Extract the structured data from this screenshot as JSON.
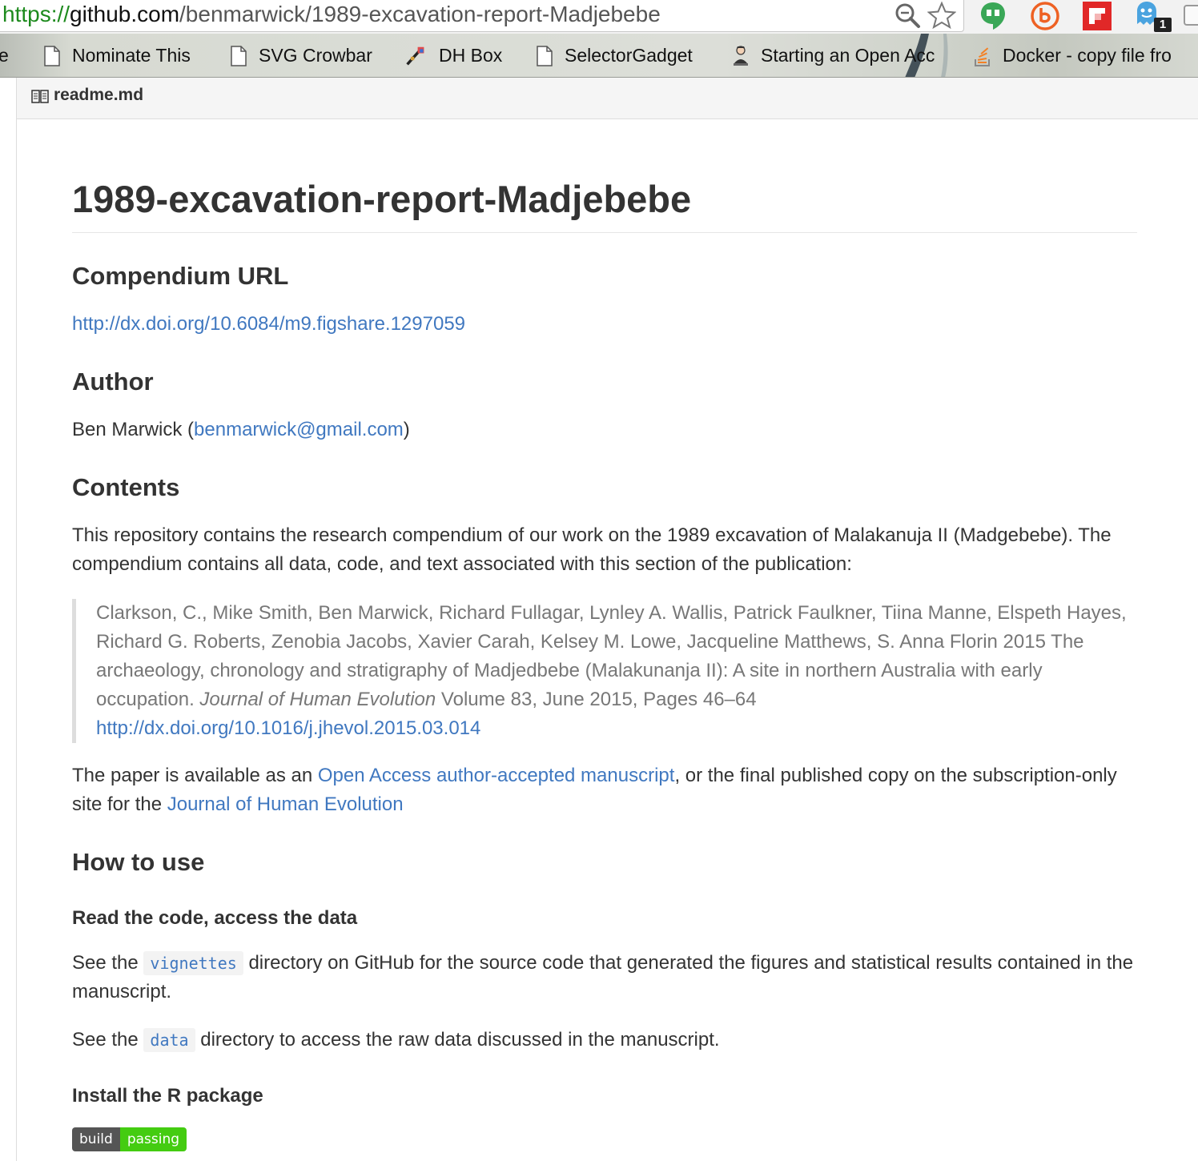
{
  "browser": {
    "url": {
      "scheme": "https://",
      "host": "github.com",
      "path": "/benmarwick/1989-excavation-report-Madjebebe"
    },
    "icons": [
      "zoom-icon",
      "bookmark-star-icon",
      "hangouts-icon",
      "bitly-icon",
      "flipboard-icon",
      "ghostery-icon"
    ],
    "ghostery_count": "1"
  },
  "bookmarks": {
    "partial_left": "e",
    "items": [
      {
        "label": "Nominate This",
        "icon": "page-icon"
      },
      {
        "label": "SVG Crowbar",
        "icon": "page-icon"
      },
      {
        "label": "DH Box",
        "icon": "box-icon"
      },
      {
        "label": "SelectorGadget",
        "icon": "page-icon"
      },
      {
        "label": "Starting an Open Acc",
        "icon": "person-icon"
      },
      {
        "label": "Docker - copy file fro",
        "icon": "stackoverflow-icon"
      }
    ]
  },
  "file": {
    "name": "readme.md"
  },
  "readme": {
    "title": "1989-excavation-report-Madjebebe",
    "compendium_heading": "Compendium URL",
    "compendium_url": "http://dx.doi.org/10.6084/m9.figshare.1297059",
    "author_heading": "Author",
    "author_name_prefix": "Ben Marwick (",
    "author_email": "benmarwick@gmail.com",
    "author_name_suffix": ")",
    "contents_heading": "Contents",
    "contents_text": "This repository contains the research compendium of our work on the 1989 excavation of Malakanuja II (Madgebebe). The compendium contains all data, code, and text associated with this section of the publication:",
    "citation_text": "Clarkson, C., Mike Smith, Ben Marwick, Richard Fullagar, Lynley A. Wallis, Patrick Faulkner, Tiina Manne, Elspeth Hayes, Richard G. Roberts, Zenobia Jacobs, Xavier Carah, Kelsey M. Lowe, Jacqueline Matthews, S. Anna Florin 2015 The archaeology, chronology and stratigraphy of Madjedbebe (Malakunanja II): A site in northern Australia with early occupation. ",
    "citation_journal": "Journal of Human Evolution",
    "citation_rest": " Volume 83, June 2015, Pages 46–64",
    "citation_url": "http://dx.doi.org/10.1016/j.jhevol.2015.03.014",
    "paper_text_1": "The paper is available as an ",
    "paper_link_1": "Open Access author-accepted manuscript",
    "paper_text_2": ", or the final published copy on the subscription-only site for the ",
    "paper_link_2": "Journal of Human Evolution",
    "howto_heading": "How to use",
    "read_heading": "Read the code, access the data",
    "see_the_1": "See the ",
    "vignettes_code": "vignettes",
    "vignettes_text": " directory on GitHub for the source code that generated the figures and statistical results contained in the manuscript.",
    "see_the_2": "See the ",
    "data_code": "data",
    "data_text": " directory to access the raw data discussed in the manuscript.",
    "install_heading": "Install the R package",
    "badge_left": "build",
    "badge_right": "passing"
  },
  "colors": {
    "link": "#4078c0",
    "badge_left": "#555555",
    "badge_right": "#44cc11",
    "url_scheme": "#1d8a1d"
  }
}
